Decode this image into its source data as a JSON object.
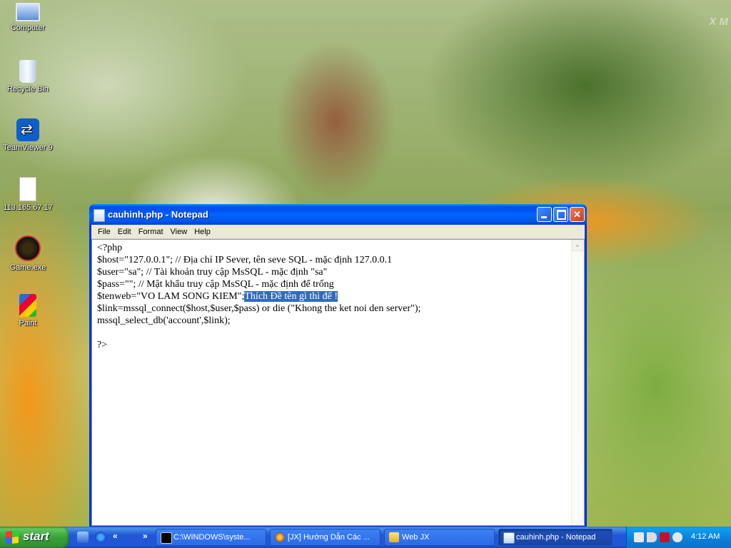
{
  "desktop": {
    "watermark": "X M",
    "icons": [
      {
        "label": "Computer",
        "icon": "computer-icon"
      },
      {
        "label": "Recycle Bin",
        "icon": "recycle-bin-icon"
      },
      {
        "label": "TeamViewer 9",
        "icon": "teamviewer-icon"
      },
      {
        "label": "113.165.67.17",
        "icon": "file-icon"
      },
      {
        "label": "Game.exe",
        "icon": "game-icon"
      },
      {
        "label": "Paint",
        "icon": "paint-icon"
      }
    ]
  },
  "notepad": {
    "title": "cauhinh.php - Notepad",
    "menu": [
      "File",
      "Edit",
      "Format",
      "View",
      "Help"
    ],
    "lines": [
      "<?php",
      "$host=\"127.0.0.1\"; // Địa chỉ IP Sever, tên seve SQL - mặc định 127.0.0.1",
      "$user=\"sa\"; // Tài khoản truy cập MsSQL - mặc định \"sa\"",
      "$pass=\"\"; // Mật khẩu truy cập MsSQL - mặc định để trống",
      "$tenweb=\"VO LAM SONG KIEM\";",
      "$link=mssql_connect($host,$user,$pass) or die (\"Khong the ket noi den server\");",
      "mssql_select_db('account',$link);",
      "",
      "?>"
    ],
    "selected_text": "Thích Đề tên gì thì để !"
  },
  "taskbar": {
    "start_label": "start",
    "tasks": [
      {
        "label": "C:\\WINDOWS\\syste...",
        "icon": "cmd-icon"
      },
      {
        "label": "[JX] Hướng Dẫn Các ...",
        "icon": "firefox-icon"
      },
      {
        "label": "Web JX",
        "icon": "folder-icon"
      },
      {
        "label": "cauhinh.php - Notepad",
        "icon": "notepad-icon"
      }
    ],
    "clock": "4:12 AM"
  },
  "colors": {
    "selection": "#316ac5",
    "titlebar": "#0053ee",
    "taskbar": "#2157d7",
    "start": "#3aa13a"
  }
}
